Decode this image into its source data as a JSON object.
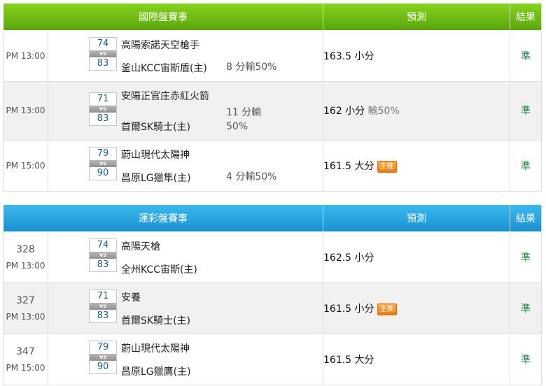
{
  "international": {
    "header": {
      "game": "國際盤賽事",
      "prediction": "預測",
      "result": "結果"
    },
    "rows": [
      {
        "time": "PM 13:00",
        "score_away": "74",
        "score_home": "83",
        "away_team": "高陽索諾天空槍手",
        "home_team": "釜山KCC宙斯盾(主)",
        "info_line1": "8 分輸50%",
        "info_line2": "",
        "prediction": "163.5 小分",
        "pred_note": "",
        "badge": "",
        "result": "準"
      },
      {
        "time": "PM 13:00",
        "score_away": "71",
        "score_home": "83",
        "away_team": "安陽正官庄赤紅火箭",
        "home_team": "首爾SK騎士(主)",
        "info_line1": "11 分輸",
        "info_line2": "50%",
        "prediction": "162 小分",
        "pred_note": "輸50%",
        "badge": "",
        "result": "準"
      },
      {
        "time": "PM 15:00",
        "score_away": "79",
        "score_home": "90",
        "away_team": "蔚山現代太陽神",
        "home_team": "昌原LG獵隼(主)",
        "info_line1": "4 分輸50%",
        "info_line2": "",
        "prediction": "161.5 大分",
        "pred_note": "",
        "badge": "主推",
        "result": "準"
      }
    ]
  },
  "lottery": {
    "header": {
      "game": "運彩盤賽事",
      "prediction": "預測",
      "result": "結果"
    },
    "rows": [
      {
        "game_no": "328",
        "time": "PM 13:00",
        "score_away": "74",
        "score_home": "83",
        "away_team": "高陽天槍",
        "home_team": "全州KCC宙斯(主)",
        "prediction": "162.5 小分",
        "badge": "",
        "result": "準"
      },
      {
        "game_no": "327",
        "time": "PM 13:00",
        "score_away": "71",
        "score_home": "83",
        "away_team": "安養",
        "home_team": "首爾SK騎士(主)",
        "prediction": "161.5 小分",
        "badge": "主推",
        "result": "準"
      },
      {
        "game_no": "347",
        "time": "PM 15:00",
        "score_away": "79",
        "score_home": "90",
        "away_team": "蔚山現代太陽神",
        "home_team": "昌原LG獵鷹(主)",
        "prediction": "161.5 大分",
        "badge": "",
        "result": "準"
      }
    ]
  },
  "vs_label": "vs",
  "colors": {
    "international_header": "#6cbf14",
    "lottery_header": "#229fdf",
    "score_text": "#1a5f86",
    "result_text": "#1a8a3a",
    "badge_bg": "#f08a1e"
  }
}
